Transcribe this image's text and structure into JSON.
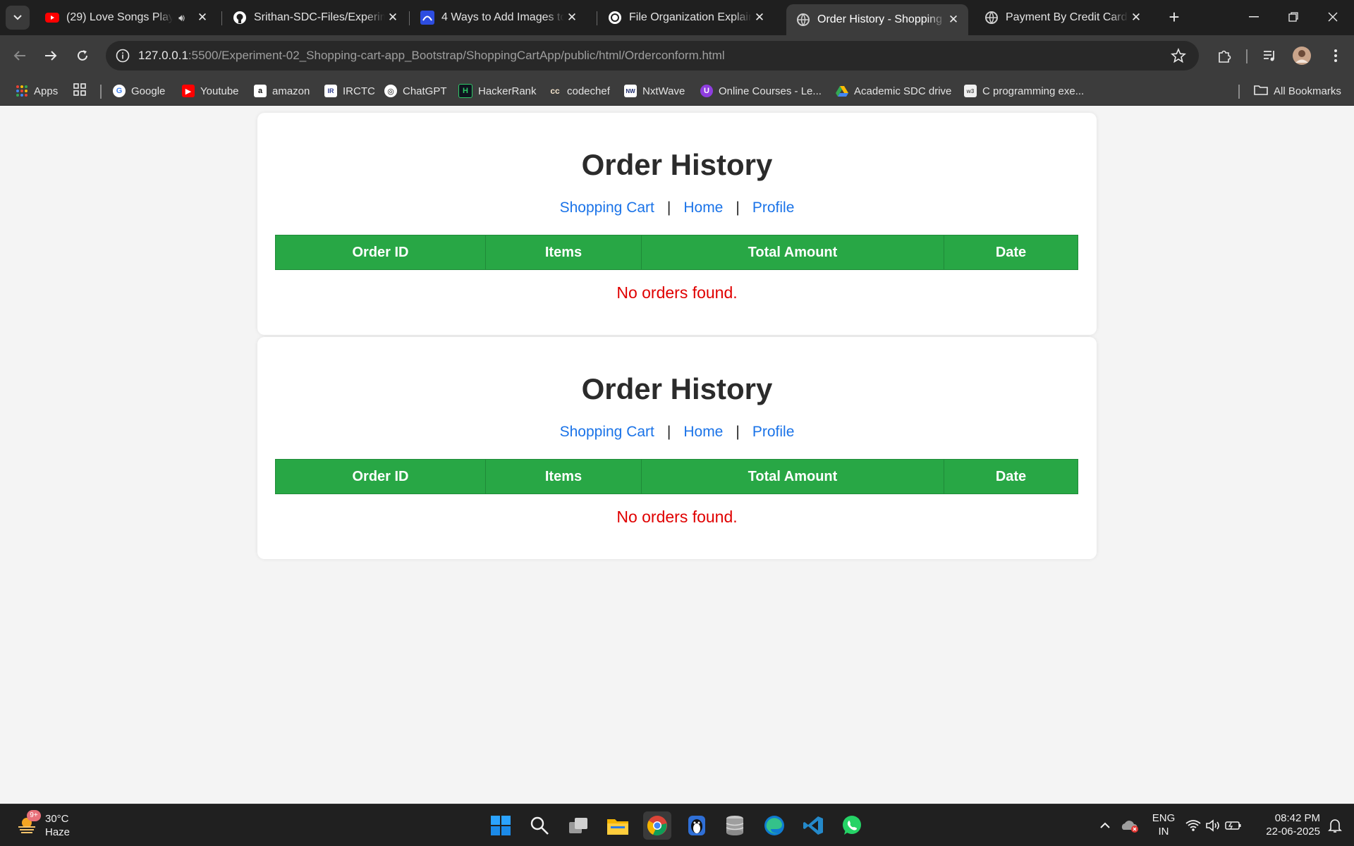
{
  "browser": {
    "tabs": [
      {
        "title": "(29) Love Songs Play List",
        "icon": "youtube-icon"
      },
      {
        "title": "Srithan-SDC-Files/Experiment",
        "icon": "github-icon"
      },
      {
        "title": "4 Ways to Add Images to GitHub",
        "icon": "site-icon"
      },
      {
        "title": "File Organization Explained",
        "icon": "chatgpt-icon"
      },
      {
        "title": "Order History - Shopping Cart",
        "icon": "globe-icon",
        "active": true
      },
      {
        "title": "Payment By Credit Card",
        "icon": "globe-icon"
      }
    ],
    "url_host": "127.0.0.1",
    "url_rest": ":5500/Experiment-02_Shopping-cart-app_Bootstrap/ShoppingCartApp/public/html/Orderconform.html",
    "bookmarks": [
      "Apps",
      "Google",
      "Youtube",
      "amazon",
      "IRCTC",
      "ChatGPT",
      "HackerRank",
      "codechef",
      "NxtWave",
      "Online Courses - Le...",
      "Academic SDC drive",
      "C programming exe..."
    ],
    "all_bookmarks": "All Bookmarks"
  },
  "page": {
    "cards": [
      {
        "title": "Order History",
        "links": [
          "Shopping Cart",
          "Home",
          "Profile"
        ],
        "separator": "|",
        "columns": [
          "Order ID",
          "Items",
          "Total Amount",
          "Date"
        ],
        "empty_message": "No orders found."
      },
      {
        "title": "Order History",
        "links": [
          "Shopping Cart",
          "Home",
          "Profile"
        ],
        "separator": "|",
        "columns": [
          "Order ID",
          "Items",
          "Total Amount",
          "Date"
        ],
        "empty_message": "No orders found."
      }
    ],
    "colors": {
      "header_green": "#28a745",
      "link_blue": "#1a73e8",
      "empty_red": "#e00000"
    }
  },
  "taskbar": {
    "weather": {
      "temp": "30°C",
      "condition": "Haze",
      "badge": "9+"
    },
    "language": {
      "line1": "ENG",
      "line2": "IN"
    },
    "clock": {
      "time": "08:42 PM",
      "date": "22-06-2025"
    }
  }
}
